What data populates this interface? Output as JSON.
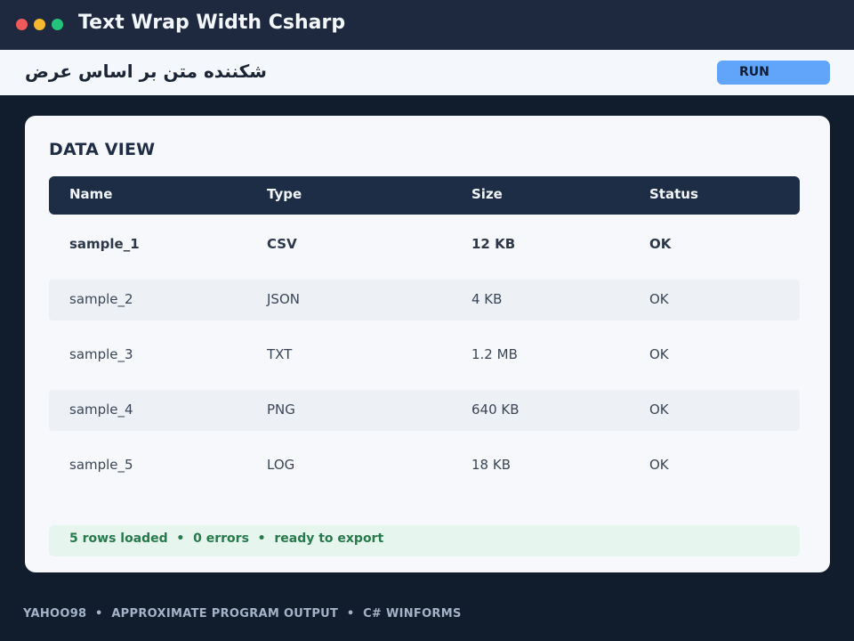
{
  "window": {
    "title": "Text Wrap Width Csharp"
  },
  "toolbar": {
    "title": "شکننده متن بر اساس عرض",
    "run_label": "RUN"
  },
  "data_view": {
    "title": "DATA VIEW",
    "columns": [
      "Name",
      "Type",
      "Size",
      "Status"
    ],
    "rows": [
      {
        "name": "sample_1",
        "type": "CSV",
        "size": "12 KB",
        "status": "OK"
      },
      {
        "name": "sample_2",
        "type": "JSON",
        "size": "4 KB",
        "status": "OK"
      },
      {
        "name": "sample_3",
        "type": "TXT",
        "size": "1.2 MB",
        "status": "OK"
      },
      {
        "name": "sample_4",
        "type": "PNG",
        "size": "640 KB",
        "status": "OK"
      },
      {
        "name": "sample_5",
        "type": "LOG",
        "size": "18 KB",
        "status": "OK"
      }
    ],
    "status": "5 rows loaded  •  0 errors  •  ready to export"
  },
  "footer": {
    "text": "YAHOO98  •  APPROXIMATE PROGRAM OUTPUT  •  C# WINFORMS"
  },
  "colors": {
    "background": "#111c2c",
    "titlebar": "#1e293f",
    "accent": "#60a5fa",
    "header_row": "#1e2d46",
    "status_bg": "#e6f6ee",
    "status_text": "#28794c",
    "window_close": "#f05a5a",
    "window_minimize": "#f5b82e",
    "window_maximize": "#24c27a"
  }
}
